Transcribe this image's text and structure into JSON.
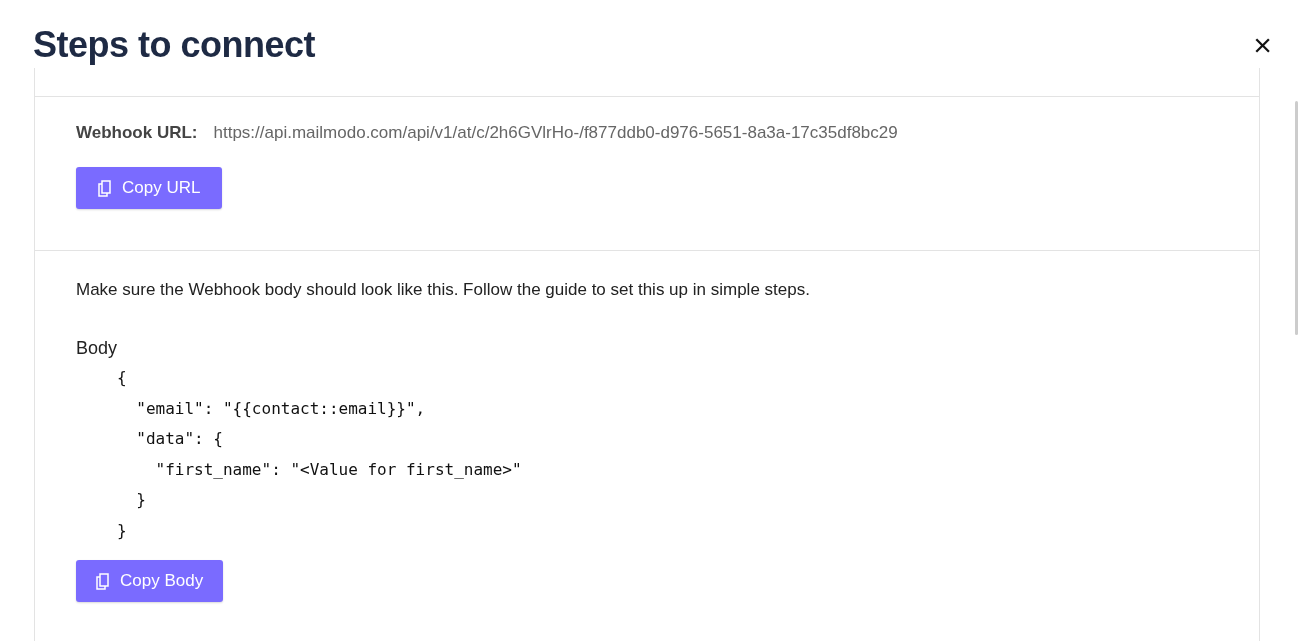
{
  "dialog": {
    "title": "Steps to connect",
    "close": "×"
  },
  "webhook": {
    "label": "Webhook URL:",
    "url": "https://api.mailmodo.com/api/v1/at/c/2h6GVlrHo-/f877ddb0-d976-5651-8a3a-17c35df8bc29",
    "button": "Copy URL"
  },
  "body_section": {
    "instruction": "Make sure the Webhook body should look like this. Follow the guide to set this up in simple steps.",
    "label": "Body",
    "code_lines": [
      "{",
      "  \"email\": \"{{contact::email}}\",",
      "  \"data\": {",
      "    \"first_name\": \"<Value for first_name>\"",
      "  }",
      "}"
    ],
    "button": "Copy Body"
  }
}
